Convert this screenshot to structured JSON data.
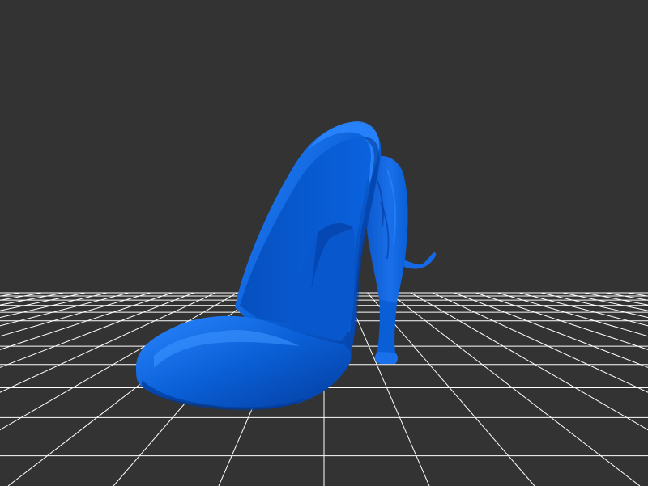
{
  "scene": {
    "background_color": "#333333",
    "grid_color": "#ffffff",
    "model_color": "#0a5fd6",
    "model_highlight": "#2a86ff",
    "model_shadow": "#033a99",
    "objects": [
      "high-heel-shoe",
      "lion-figure"
    ]
  }
}
